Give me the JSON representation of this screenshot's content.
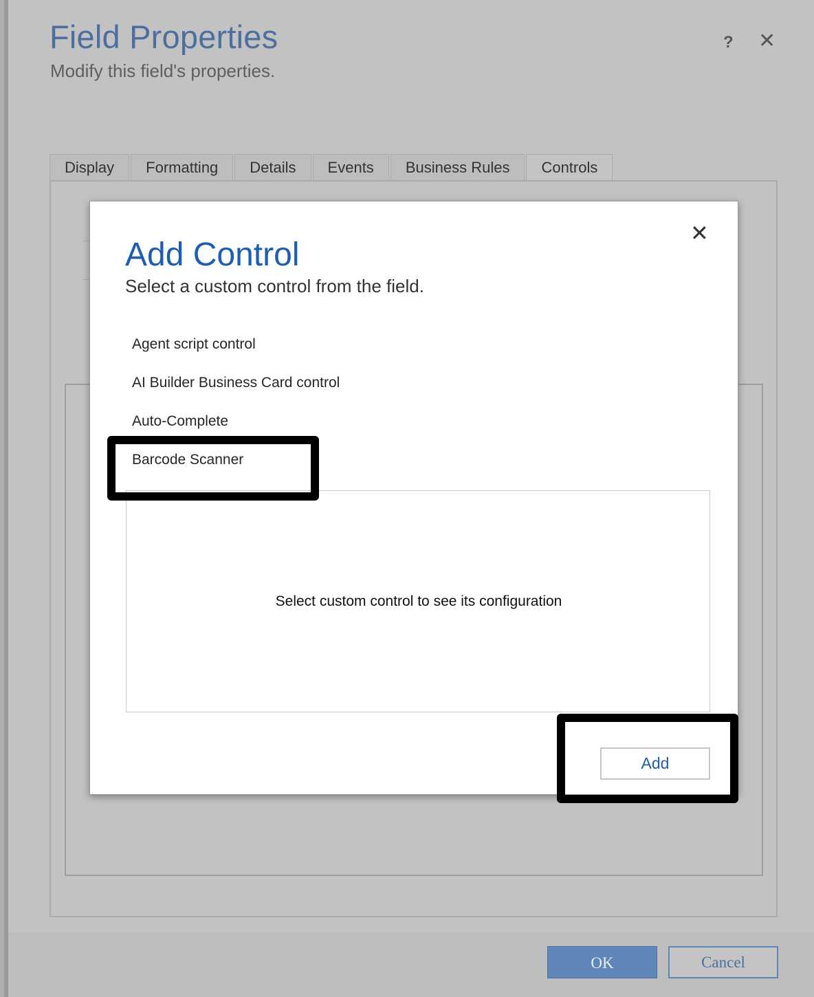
{
  "dialog": {
    "title": "Field Properties",
    "subtitle": "Modify this field's properties.",
    "help_icon": "?",
    "close_icon": "✕"
  },
  "tabs": [
    {
      "label": "Display"
    },
    {
      "label": "Formatting"
    },
    {
      "label": "Details"
    },
    {
      "label": "Events"
    },
    {
      "label": "Business Rules"
    },
    {
      "label": "Controls",
      "active": true
    }
  ],
  "footer": {
    "ok_label": "OK",
    "cancel_label": "Cancel"
  },
  "add_control": {
    "title": "Add Control",
    "subtitle": "Select a custom control from the field.",
    "close_icon": "✕",
    "controls": [
      {
        "label": "Agent script control"
      },
      {
        "label": "AI Builder Business Card control"
      },
      {
        "label": "Auto-Complete"
      },
      {
        "label": "Barcode Scanner"
      }
    ],
    "config_placeholder": "Select custom control to see its configuration",
    "add_label": "Add"
  },
  "colors": {
    "dialog_title": "#4d6f9f",
    "modal_title": "#1d5db4",
    "ok_button": "#5f86b8",
    "highlight": "#000000"
  }
}
